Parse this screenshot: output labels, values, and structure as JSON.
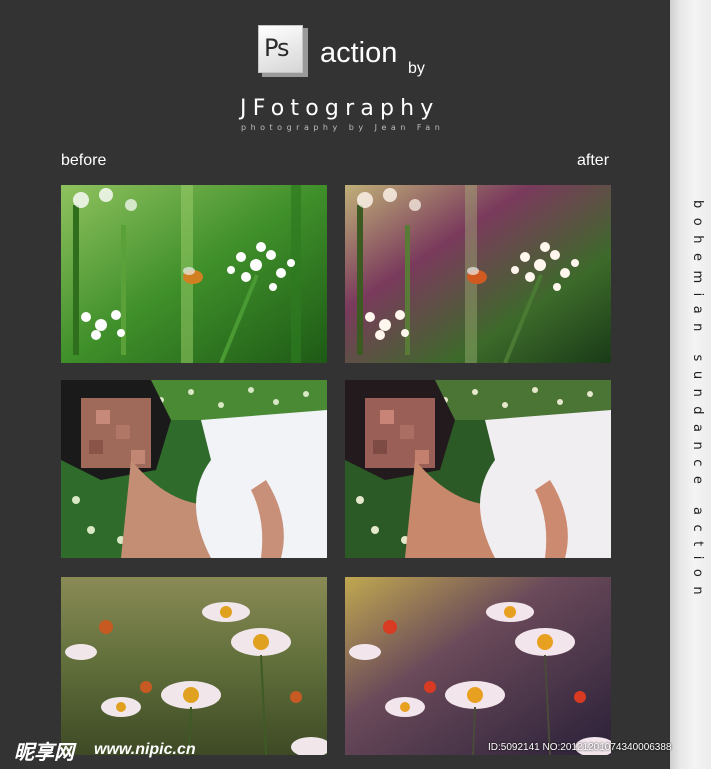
{
  "header": {
    "logo_text": "Ps",
    "title": "action",
    "by": "by",
    "brand": "JFotography",
    "brand_subtitle": "photography by Jean Fan"
  },
  "labels": {
    "before": "before",
    "after": "after"
  },
  "sidebar": {
    "text": "bohemian sundance action"
  },
  "photos": [
    {
      "subject": "flower-bee",
      "before": "flower-bee-before",
      "after": "flower-bee-after"
    },
    {
      "subject": "girl-lying-in-grass",
      "before": "girl-before",
      "after": "girl-after"
    },
    {
      "subject": "daisies",
      "before": "daisies-before",
      "after": "daisies-after"
    }
  ],
  "watermark": {
    "logo": "昵享网",
    "url": "www.nipic.cn",
    "id": "ID:5092141 NO:20121201074340006388"
  },
  "colors": {
    "background": "#333333",
    "sidebar": "#eeeeee",
    "text": "#ffffff"
  }
}
